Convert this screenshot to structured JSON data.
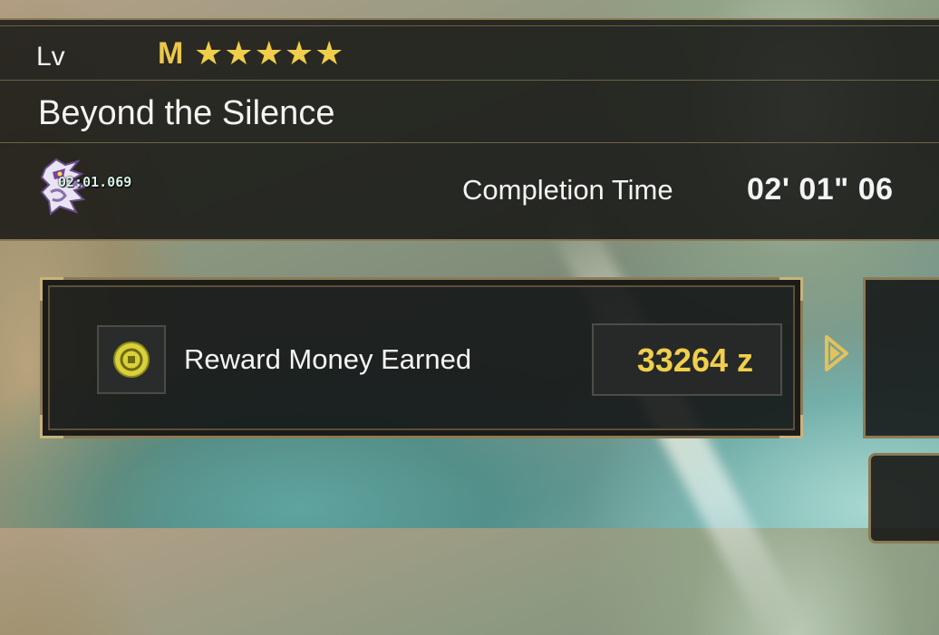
{
  "quest": {
    "level_label": "Lv",
    "rank_letter": "M",
    "star_count": 5,
    "stars": [
      "★",
      "★",
      "★",
      "★",
      "★"
    ],
    "title": "Beyond the Silence",
    "monster_icon": "monster-icon",
    "timer_overlay": "02:01.069",
    "completion_label": "Completion Time",
    "completion_value": "02' 01\" 06"
  },
  "reward": {
    "icon": "coin-icon",
    "label": "Reward Money Earned",
    "value": "33264 z"
  },
  "colors": {
    "gold": "#f0cd4a",
    "panel_border": "#8c7b55",
    "text": "#f4f4f4"
  }
}
